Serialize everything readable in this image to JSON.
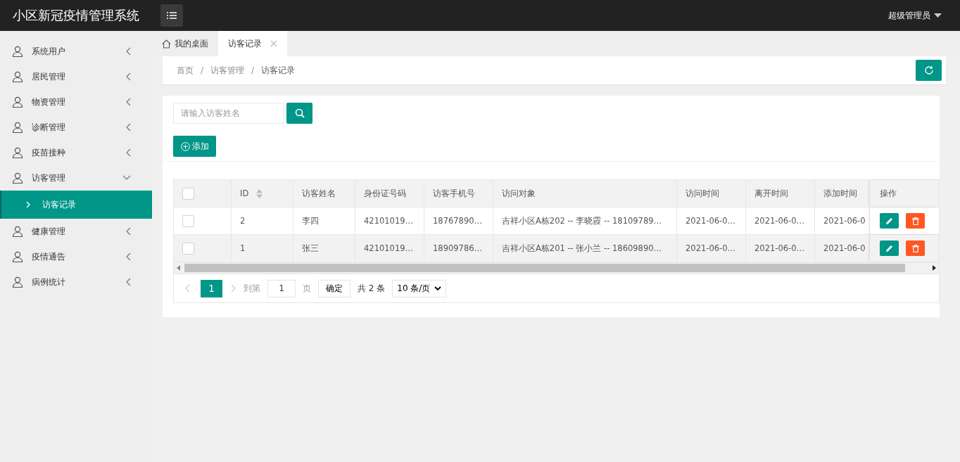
{
  "header": {
    "title": "小区新冠疫情管理系统",
    "user": "超级管理员"
  },
  "sidebar": {
    "items": [
      {
        "label": "系统用户",
        "expanded": false
      },
      {
        "label": "居民管理",
        "expanded": false
      },
      {
        "label": "物资管理",
        "expanded": false
      },
      {
        "label": "诊断管理",
        "expanded": false
      },
      {
        "label": "疫苗接种",
        "expanded": false
      },
      {
        "label": "访客管理",
        "expanded": true,
        "children": [
          {
            "label": "访客记录",
            "selected": true
          }
        ]
      },
      {
        "label": "健康管理",
        "expanded": false
      },
      {
        "label": "疫情通告",
        "expanded": false
      },
      {
        "label": "病例统计",
        "expanded": false
      }
    ]
  },
  "tabs": [
    {
      "label": "我的桌面",
      "kind": "home",
      "selected": false
    },
    {
      "label": "访客记录",
      "kind": "closable",
      "selected": true
    }
  ],
  "breadcrumb": [
    "首页",
    "访客管理",
    "访客记录"
  ],
  "breadcrumb_separator": "/",
  "search": {
    "placeholder": "请输入访客姓名"
  },
  "add_button": "添加",
  "table": {
    "header_checked": false,
    "columns": [
      "ID",
      "访客姓名",
      "身份证号码",
      "访客手机号",
      "访问对象",
      "访问时间",
      "离开时间",
      "添加时间",
      "操作"
    ],
    "rows": [
      {
        "checked": false,
        "cells": [
          "2",
          "李四",
          "42101019…",
          "18767890…",
          "吉祥小区A栋202 -- 李晓霞 -- 18109789…",
          "2021-06-0…",
          "2021-06-0…",
          "2021-06-0"
        ]
      },
      {
        "checked": false,
        "cells": [
          "1",
          "张三",
          "42101019…",
          "18909786…",
          "吉祥小区A栋201 -- 张小兰 -- 18609890…",
          "2021-06-0…",
          "2021-06-0…",
          "2021-06-0"
        ]
      }
    ]
  },
  "pagination": {
    "pages": [
      {
        "label": "1",
        "selected": true
      }
    ],
    "goto_label": "到第",
    "goto_value": "1",
    "page_unit": "页",
    "confirm": "确定",
    "total": "共 2 条",
    "page_size": "10 条/页"
  }
}
